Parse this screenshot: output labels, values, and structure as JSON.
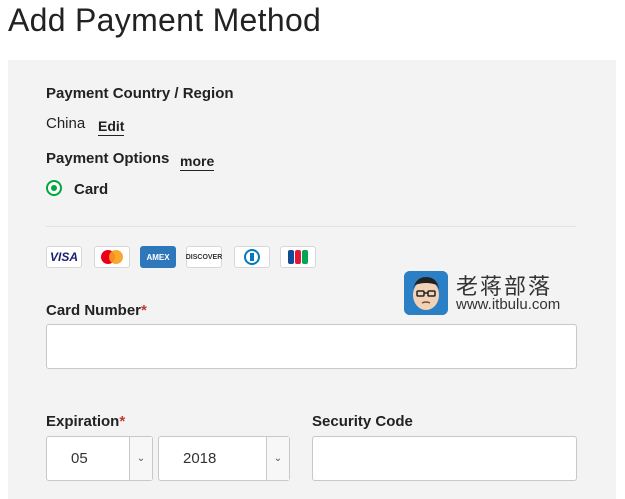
{
  "page": {
    "title": "Add Payment Method"
  },
  "country": {
    "label": "Payment Country / Region",
    "value": "China",
    "edit_link": "Edit"
  },
  "payment_options": {
    "label": "Payment Options",
    "more_link": "more",
    "selected_option": "Card"
  },
  "card_brands": [
    {
      "name": "VISA"
    },
    {
      "name": "Mastercard"
    },
    {
      "name": "AMEX"
    },
    {
      "name": "DISCOVER"
    },
    {
      "name": "Diners"
    },
    {
      "name": "JCB"
    }
  ],
  "card_number": {
    "label": "Card Number",
    "required_mark": "*",
    "value": ""
  },
  "expiration": {
    "label": "Expiration",
    "required_mark": "*",
    "month": "05",
    "year": "2018"
  },
  "security_code": {
    "label": "Security Code",
    "value": ""
  },
  "watermark": {
    "name": "老蒋部落",
    "url": "www.itbulu.com"
  },
  "colors": {
    "accent_green": "#00a63f",
    "panel_bg": "#f3f3f3",
    "required_red": "#c0392b"
  }
}
